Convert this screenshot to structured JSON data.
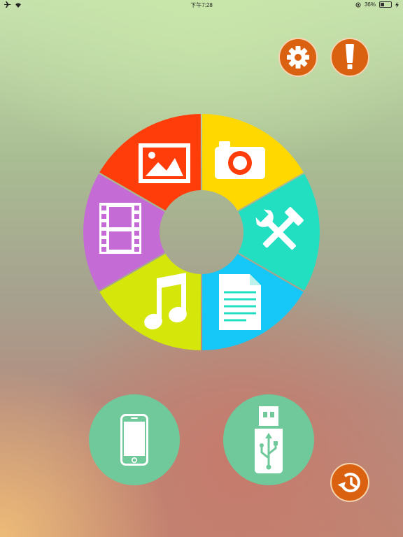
{
  "status_bar": {
    "airplane_icon": "airplane-icon",
    "wifi_icon": "wifi-icon",
    "time": "下午7:28",
    "battery_percent": "36%",
    "battery_level": 0.36
  },
  "top_buttons": {
    "settings_icon": "gear-icon",
    "info_icon": "exclamation-icon",
    "color": "#d9610f"
  },
  "wheel": {
    "segments": [
      {
        "name": "photos",
        "icon": "image-icon",
        "color": "#c56bd6"
      },
      {
        "name": "camera",
        "icon": "camera-icon",
        "color": "#ff3d0a"
      },
      {
        "name": "tools",
        "icon": "tools-icon",
        "color": "#ffd800"
      },
      {
        "name": "documents",
        "icon": "document-icon",
        "color": "#22dfc2"
      },
      {
        "name": "music",
        "icon": "music-note-icon",
        "color": "#15c8f7"
      },
      {
        "name": "videos",
        "icon": "film-icon",
        "color": "#d5e60a"
      }
    ]
  },
  "bottom": {
    "phone_icon": "iphone-icon",
    "usb_icon": "usb-drive-icon",
    "history_icon": "history-icon",
    "device_color": "#6fc99a"
  }
}
